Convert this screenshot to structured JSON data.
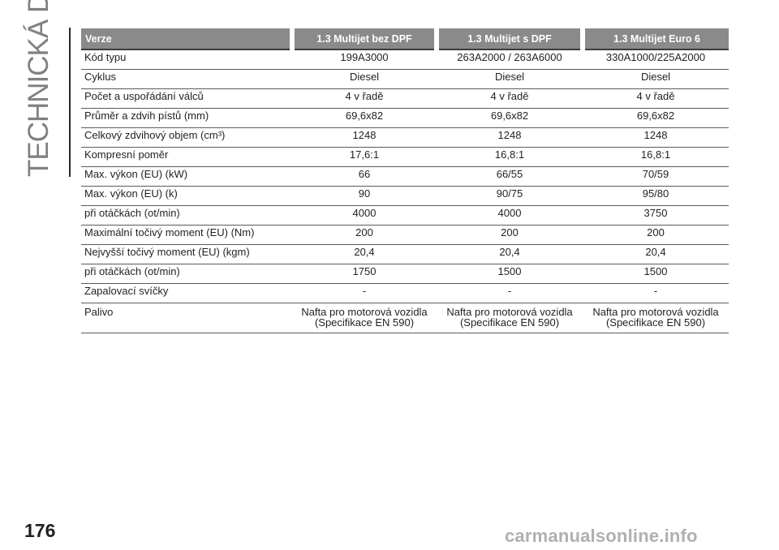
{
  "side_title": "TECHNICKÁ DATA",
  "page_number": "176",
  "watermark": "carmanualsonline.info",
  "table": {
    "headers": [
      "Verze",
      "1.3 Multijet bez DPF",
      "1.3 Multijet s DPF",
      "1.3 Multijet Euro 6"
    ],
    "rows": [
      [
        "Kód typu",
        "199A3000",
        "263A2000 / 263A6000",
        "330A1000/225A2000"
      ],
      [
        "Cyklus",
        "Diesel",
        "Diesel",
        "Diesel"
      ],
      [
        "Počet a uspořádání válců",
        "4 v řadě",
        "4 v řadě",
        "4 v řadě"
      ],
      [
        "Průměr a zdvih pístů (mm)",
        "69,6x82",
        "69,6x82",
        "69,6x82"
      ],
      [
        "Celkový zdvihový objem (cm³)",
        "1248",
        "1248",
        "1248"
      ],
      [
        "Kompresní poměr",
        "17,6:1",
        "16,8:1",
        "16,8:1"
      ],
      [
        "Max. výkon (EU) (kW)",
        "66",
        "66/55",
        "70/59"
      ],
      [
        "Max. výkon (EU) (k)",
        "90",
        "90/75",
        "95/80"
      ],
      [
        "při otáčkách (ot/min)",
        "4000",
        "4000",
        "3750"
      ],
      [
        "Maximální točivý moment (EU) (Nm)",
        "200",
        "200",
        "200"
      ],
      [
        "Nejvyšší točivý moment (EU) (kgm)",
        "20,4",
        "20,4",
        "20,4"
      ],
      [
        "při otáčkách (ot/min)",
        "1750",
        "1500",
        "1500"
      ],
      [
        "Zapalovací svíčky",
        "-",
        "-",
        "-"
      ]
    ],
    "fuel_row": {
      "label": "Palivo",
      "values": [
        [
          "Nafta pro motorová vozidla",
          "(Specifikace EN 590)"
        ],
        [
          "Nafta pro motorová vozidla",
          "(Specifikace EN 590)"
        ],
        [
          "Nafta pro motorová vozidla",
          "(Specifikace EN 590)"
        ]
      ]
    }
  }
}
